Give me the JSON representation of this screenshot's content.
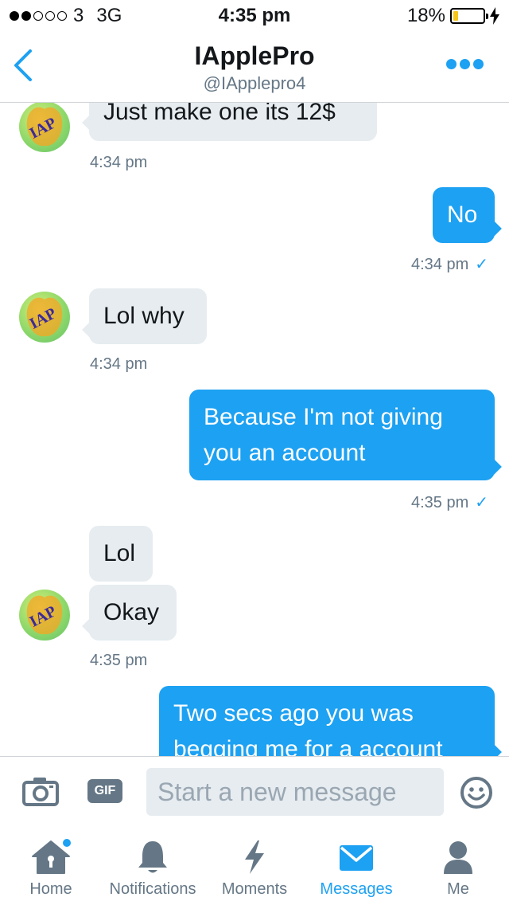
{
  "status_bar": {
    "carrier": "3",
    "network": "3G",
    "time": "4:35 pm",
    "battery_percent": "18%",
    "battery_level": 0.18,
    "signal_bars_filled": 2,
    "signal_bars_total": 5
  },
  "header": {
    "title": "IApplePro",
    "handle": "@IApplepro4"
  },
  "messages": [
    {
      "id": "m1",
      "direction": "in",
      "text": "Just make one its 12$"
    },
    {
      "id": "t1",
      "type": "timestamp",
      "text": "4:34 pm"
    },
    {
      "id": "m2",
      "direction": "out",
      "text": "No"
    },
    {
      "id": "t2",
      "type": "timestamp",
      "text": "4:34 pm",
      "read_check": "✓"
    },
    {
      "id": "m3",
      "direction": "in",
      "text": "Lol why"
    },
    {
      "id": "t3",
      "type": "timestamp",
      "text": "4:34 pm"
    },
    {
      "id": "m4",
      "direction": "out",
      "lines": [
        "Because I'm not giving",
        "you an account"
      ]
    },
    {
      "id": "t4",
      "type": "timestamp",
      "text": "4:35 pm",
      "read_check": "✓"
    },
    {
      "id": "m5",
      "direction": "in",
      "text": "Lol"
    },
    {
      "id": "m6",
      "direction": "in",
      "text": "Okay"
    },
    {
      "id": "t5",
      "type": "timestamp",
      "text": "4:35 pm"
    },
    {
      "id": "m7",
      "direction": "out",
      "lines": [
        "Two secs ago you was",
        "begging me for a account"
      ]
    }
  ],
  "avatar_text": "IAP",
  "composer": {
    "gif_label": "GIF",
    "placeholder": "Start a new message"
  },
  "tabs": [
    {
      "label": "Home",
      "icon": "home-icon",
      "badge": true
    },
    {
      "label": "Notifications",
      "icon": "bell-icon"
    },
    {
      "label": "Moments",
      "icon": "lightning-icon"
    },
    {
      "label": "Messages",
      "icon": "envelope-icon",
      "active": true
    },
    {
      "label": "Me",
      "icon": "person-icon"
    }
  ],
  "colors": {
    "accent": "#1da1f2",
    "incoming_bubble": "#e6ecf0",
    "muted_text": "#657786",
    "battery_fill": "#f5c518"
  }
}
